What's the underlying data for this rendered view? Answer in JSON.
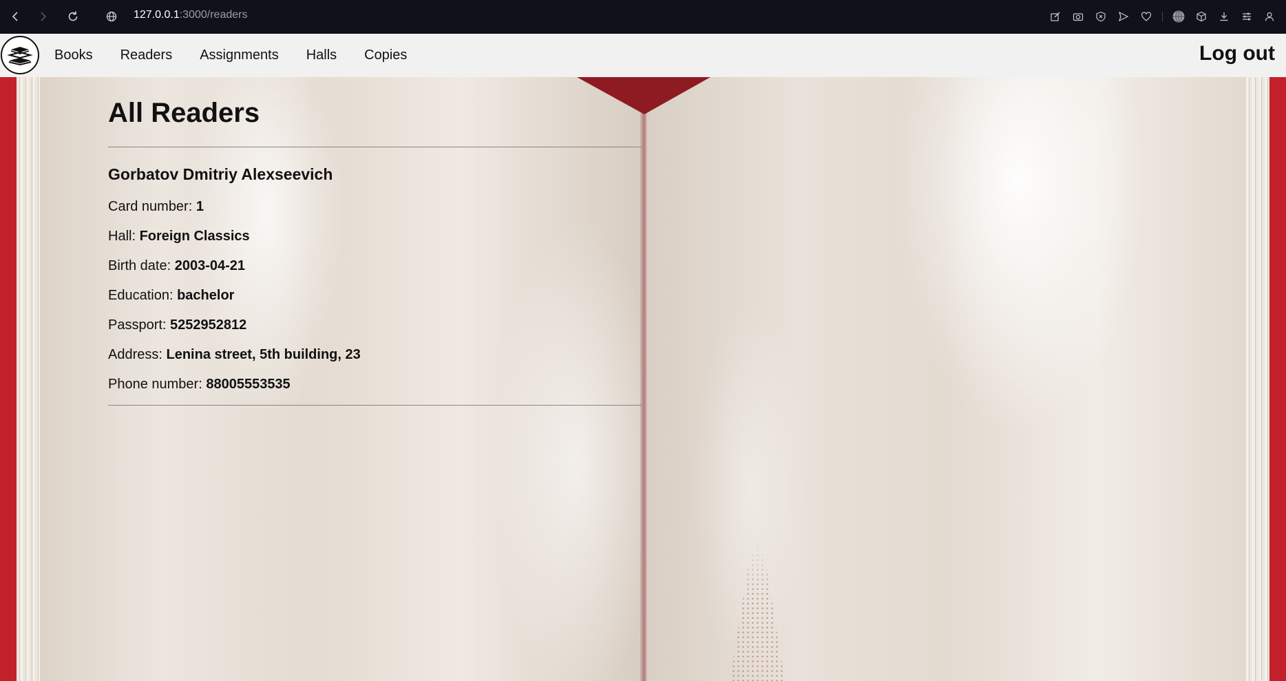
{
  "browser": {
    "url_host": "127.0.0.1",
    "url_path": ":3000/readers"
  },
  "navbar": {
    "links": [
      "Books",
      "Readers",
      "Assignments",
      "Halls",
      "Copies"
    ],
    "logout_label": "Log out"
  },
  "page": {
    "title": "All Readers"
  },
  "reader": {
    "name": "Gorbatov Dmitriy Alexseevich",
    "fields": [
      {
        "label": "Card number: ",
        "value": "1"
      },
      {
        "label": "Hall: ",
        "value": "Foreign Classics"
      },
      {
        "label": "Birth date: ",
        "value": "2003-04-21"
      },
      {
        "label": "Education: ",
        "value": "bachelor"
      },
      {
        "label": "Passport: ",
        "value": "5252952812"
      },
      {
        "label": "Address: ",
        "value": "Lenina street, 5th building, 23"
      },
      {
        "label": "Phone number: ",
        "value": "88005553535"
      }
    ]
  },
  "colors": {
    "cover": "#c2202b",
    "ribbon": "#8e1a22",
    "chrome_bg": "#11111c",
    "navbar_bg": "#f1f1f1"
  }
}
